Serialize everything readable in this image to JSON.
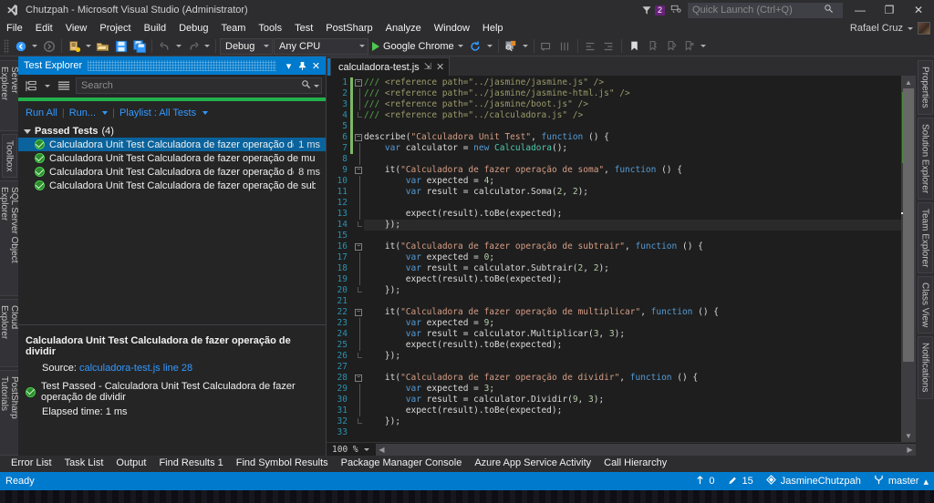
{
  "window": {
    "title": "Chutzpah - Microsoft Visual Studio (Administrator)",
    "minimize": "—",
    "restore": "❐",
    "close": "✕",
    "notification_count": "2",
    "user_name": "Rafael Cruz"
  },
  "quick_launch": {
    "placeholder": "Quick Launch (Ctrl+Q)",
    "value": ""
  },
  "menu": {
    "items": [
      {
        "label": "File"
      },
      {
        "label": "Edit"
      },
      {
        "label": "View"
      },
      {
        "label": "Project"
      },
      {
        "label": "Build"
      },
      {
        "label": "Debug"
      },
      {
        "label": "Team"
      },
      {
        "label": "Tools"
      },
      {
        "label": "Test"
      },
      {
        "label": "PostSharp"
      },
      {
        "label": "Analyze"
      },
      {
        "label": "Window"
      },
      {
        "label": "Help"
      }
    ]
  },
  "toolbar": {
    "config": "Debug",
    "platform": "Any CPU",
    "run_target": "Google Chrome"
  },
  "left_tabs": [
    {
      "label": "Server Explorer"
    },
    {
      "label": "Toolbox"
    },
    {
      "label": "SQL Server Object Explorer"
    },
    {
      "label": "Cloud Explorer"
    },
    {
      "label": "PostSharp Tutorials"
    }
  ],
  "right_tabs": [
    {
      "label": "Properties"
    },
    {
      "label": "Solution Explorer"
    },
    {
      "label": "Team Explorer"
    },
    {
      "label": "Class View"
    },
    {
      "label": "Notifications"
    }
  ],
  "test_explorer": {
    "title": "Test Explorer",
    "dropdown_glyph": "▾",
    "pin_glyph": "✕",
    "close_glyph": "✕",
    "search": {
      "placeholder": "Search",
      "value": ""
    },
    "run_all": "Run All",
    "run": "Run...",
    "playlist": "Playlist : All Tests",
    "group": {
      "label": "Passed Tests",
      "count": "(4)"
    },
    "tests": [
      {
        "name": "Calculadora Unit Test Calculadora de fazer operação de dividir",
        "duration": "1 ms",
        "selected": true
      },
      {
        "name": "Calculadora Unit Test Calculadora de fazer operação de multiplicar",
        "duration": "",
        "selected": false
      },
      {
        "name": "Calculadora Unit Test Calculadora de fazer operação de soma",
        "duration": "8 ms",
        "selected": false
      },
      {
        "name": "Calculadora Unit Test Calculadora de fazer operação de subtrair",
        "duration": "",
        "selected": false
      }
    ],
    "detail": {
      "title": "Calculadora Unit Test Calculadora de fazer operação de dividir",
      "source_label": "Source:",
      "source_link": "calculadora-test.js line 28",
      "result": "Test Passed - Calculadora Unit Test Calculadora de fazer operação de dividir",
      "elapsed": "Elapsed time: 1 ms"
    }
  },
  "editor": {
    "tab": {
      "label": "calculadora-test.js",
      "pin": "⇲",
      "close": "✕"
    },
    "zoom": "100 %",
    "lines": [
      {
        "n": 1,
        "fold": "box",
        "tokens": [
          {
            "t": "/// ",
            "c": "c-com"
          },
          {
            "t": "<reference path=\"../jasmine/jasmine.js\" />",
            "c": "c-comx"
          }
        ]
      },
      {
        "n": 2,
        "fold": "bar",
        "tokens": [
          {
            "t": "/// ",
            "c": "c-com"
          },
          {
            "t": "<reference path=\"../jasmine/jasmine-html.js\" />",
            "c": "c-comx"
          }
        ]
      },
      {
        "n": 3,
        "fold": "bar",
        "tokens": [
          {
            "t": "/// ",
            "c": "c-com"
          },
          {
            "t": "<reference path=\"../jasmine/boot.js\" />",
            "c": "c-comx"
          }
        ]
      },
      {
        "n": 4,
        "fold": "end",
        "tokens": [
          {
            "t": "/// ",
            "c": "c-com"
          },
          {
            "t": "<reference path=\"../calculadora.js\" />",
            "c": "c-comx"
          }
        ]
      },
      {
        "n": 5,
        "fold": "",
        "tokens": []
      },
      {
        "n": 6,
        "fold": "box",
        "tokens": [
          {
            "t": "describe",
            "c": "c-pl"
          },
          {
            "t": "(",
            "c": "c-pl"
          },
          {
            "t": "\"Calculadora Unit Test\"",
            "c": "c-str"
          },
          {
            "t": ", ",
            "c": "c-pl"
          },
          {
            "t": "function",
            "c": "c-kw"
          },
          {
            "t": " () {",
            "c": "c-pl"
          }
        ]
      },
      {
        "n": 7,
        "fold": "bar",
        "tokens": [
          {
            "t": "    ",
            "c": "c-pl"
          },
          {
            "t": "var",
            "c": "c-kw"
          },
          {
            "t": " calculator = ",
            "c": "c-pl"
          },
          {
            "t": "new",
            "c": "c-kw"
          },
          {
            "t": " ",
            "c": "c-pl"
          },
          {
            "t": "Calculadora",
            "c": "c-type"
          },
          {
            "t": "();",
            "c": "c-pl"
          }
        ]
      },
      {
        "n": 8,
        "fold": "bar",
        "tokens": []
      },
      {
        "n": 9,
        "fold": "box",
        "tokens": [
          {
            "t": "    ",
            "c": "c-pl"
          },
          {
            "t": "it",
            "c": "c-pl"
          },
          {
            "t": "(",
            "c": "c-pl"
          },
          {
            "t": "\"Calculadora de fazer operação de soma\"",
            "c": "c-str"
          },
          {
            "t": ", ",
            "c": "c-pl"
          },
          {
            "t": "function",
            "c": "c-kw"
          },
          {
            "t": " () {",
            "c": "c-pl"
          }
        ]
      },
      {
        "n": 10,
        "fold": "bar",
        "tokens": [
          {
            "t": "        ",
            "c": "c-pl"
          },
          {
            "t": "var",
            "c": "c-kw"
          },
          {
            "t": " expected = ",
            "c": "c-pl"
          },
          {
            "t": "4",
            "c": "c-num"
          },
          {
            "t": ";",
            "c": "c-pl"
          }
        ]
      },
      {
        "n": 11,
        "fold": "bar",
        "tokens": [
          {
            "t": "        ",
            "c": "c-pl"
          },
          {
            "t": "var",
            "c": "c-kw"
          },
          {
            "t": " result = calculator.Soma(",
            "c": "c-pl"
          },
          {
            "t": "2",
            "c": "c-num"
          },
          {
            "t": ", ",
            "c": "c-pl"
          },
          {
            "t": "2",
            "c": "c-num"
          },
          {
            "t": ");",
            "c": "c-pl"
          }
        ]
      },
      {
        "n": 12,
        "fold": "bar",
        "tokens": []
      },
      {
        "n": 13,
        "fold": "bar",
        "tokens": [
          {
            "t": "        expect(result).toBe(expected);",
            "c": "c-pl"
          }
        ]
      },
      {
        "n": 14,
        "fold": "end",
        "cur": true,
        "tokens": [
          {
            "t": "    });",
            "c": "c-pl"
          }
        ]
      },
      {
        "n": 15,
        "fold": "",
        "tokens": []
      },
      {
        "n": 16,
        "fold": "box",
        "tokens": [
          {
            "t": "    ",
            "c": "c-pl"
          },
          {
            "t": "it",
            "c": "c-pl"
          },
          {
            "t": "(",
            "c": "c-pl"
          },
          {
            "t": "\"Calculadora de fazer operação de subtrair\"",
            "c": "c-str"
          },
          {
            "t": ", ",
            "c": "c-pl"
          },
          {
            "t": "function",
            "c": "c-kw"
          },
          {
            "t": " () {",
            "c": "c-pl"
          }
        ]
      },
      {
        "n": 17,
        "fold": "bar",
        "tokens": [
          {
            "t": "        ",
            "c": "c-pl"
          },
          {
            "t": "var",
            "c": "c-kw"
          },
          {
            "t": " expected = ",
            "c": "c-pl"
          },
          {
            "t": "0",
            "c": "c-num"
          },
          {
            "t": ";",
            "c": "c-pl"
          }
        ]
      },
      {
        "n": 18,
        "fold": "bar",
        "tokens": [
          {
            "t": "        ",
            "c": "c-pl"
          },
          {
            "t": "var",
            "c": "c-kw"
          },
          {
            "t": " result = calculator.Subtrair(",
            "c": "c-pl"
          },
          {
            "t": "2",
            "c": "c-num"
          },
          {
            "t": ", ",
            "c": "c-pl"
          },
          {
            "t": "2",
            "c": "c-num"
          },
          {
            "t": ");",
            "c": "c-pl"
          }
        ]
      },
      {
        "n": 19,
        "fold": "bar",
        "tokens": [
          {
            "t": "        expect(result).toBe(expected);",
            "c": "c-pl"
          }
        ]
      },
      {
        "n": 20,
        "fold": "end",
        "tokens": [
          {
            "t": "    });",
            "c": "c-pl"
          }
        ]
      },
      {
        "n": 21,
        "fold": "",
        "tokens": []
      },
      {
        "n": 22,
        "fold": "box",
        "tokens": [
          {
            "t": "    ",
            "c": "c-pl"
          },
          {
            "t": "it",
            "c": "c-pl"
          },
          {
            "t": "(",
            "c": "c-pl"
          },
          {
            "t": "\"Calculadora de fazer operação de multiplicar\"",
            "c": "c-str"
          },
          {
            "t": ", ",
            "c": "c-pl"
          },
          {
            "t": "function",
            "c": "c-kw"
          },
          {
            "t": " () {",
            "c": "c-pl"
          }
        ]
      },
      {
        "n": 23,
        "fold": "bar",
        "tokens": [
          {
            "t": "        ",
            "c": "c-pl"
          },
          {
            "t": "var",
            "c": "c-kw"
          },
          {
            "t": " expected = ",
            "c": "c-pl"
          },
          {
            "t": "9",
            "c": "c-num"
          },
          {
            "t": ";",
            "c": "c-pl"
          }
        ]
      },
      {
        "n": 24,
        "fold": "bar",
        "tokens": [
          {
            "t": "        ",
            "c": "c-pl"
          },
          {
            "t": "var",
            "c": "c-kw"
          },
          {
            "t": " result = calculator.Multiplicar(",
            "c": "c-pl"
          },
          {
            "t": "3",
            "c": "c-num"
          },
          {
            "t": ", ",
            "c": "c-pl"
          },
          {
            "t": "3",
            "c": "c-num"
          },
          {
            "t": ");",
            "c": "c-pl"
          }
        ]
      },
      {
        "n": 25,
        "fold": "bar",
        "tokens": [
          {
            "t": "        expect(result).toBe(expected);",
            "c": "c-pl"
          }
        ]
      },
      {
        "n": 26,
        "fold": "end",
        "tokens": [
          {
            "t": "    });",
            "c": "c-pl"
          }
        ]
      },
      {
        "n": 27,
        "fold": "",
        "tokens": []
      },
      {
        "n": 28,
        "fold": "box",
        "tokens": [
          {
            "t": "    ",
            "c": "c-pl"
          },
          {
            "t": "it",
            "c": "c-pl"
          },
          {
            "t": "(",
            "c": "c-pl"
          },
          {
            "t": "\"Calculadora de fazer operação de dividir\"",
            "c": "c-str"
          },
          {
            "t": ", ",
            "c": "c-pl"
          },
          {
            "t": "function",
            "c": "c-kw"
          },
          {
            "t": " () {",
            "c": "c-pl"
          }
        ]
      },
      {
        "n": 29,
        "fold": "bar",
        "tokens": [
          {
            "t": "        ",
            "c": "c-pl"
          },
          {
            "t": "var",
            "c": "c-kw"
          },
          {
            "t": " expected = ",
            "c": "c-pl"
          },
          {
            "t": "3",
            "c": "c-num"
          },
          {
            "t": ";",
            "c": "c-pl"
          }
        ]
      },
      {
        "n": 30,
        "fold": "bar",
        "tokens": [
          {
            "t": "        ",
            "c": "c-pl"
          },
          {
            "t": "var",
            "c": "c-kw"
          },
          {
            "t": " result = calculator.Dividir(",
            "c": "c-pl"
          },
          {
            "t": "9",
            "c": "c-num"
          },
          {
            "t": ", ",
            "c": "c-pl"
          },
          {
            "t": "3",
            "c": "c-num"
          },
          {
            "t": ");",
            "c": "c-pl"
          }
        ]
      },
      {
        "n": 31,
        "fold": "bar",
        "tokens": [
          {
            "t": "        expect(result).toBe(expected);",
            "c": "c-pl"
          }
        ]
      },
      {
        "n": 32,
        "fold": "end",
        "tokens": [
          {
            "t": "    });",
            "c": "c-pl"
          }
        ]
      },
      {
        "n": 33,
        "fold": "",
        "tokens": []
      }
    ]
  },
  "bottom_tabs": [
    {
      "label": "Error List"
    },
    {
      "label": "Task List"
    },
    {
      "label": "Output"
    },
    {
      "label": "Find Results 1"
    },
    {
      "label": "Find Symbol Results"
    },
    {
      "label": "Package Manager Console"
    },
    {
      "label": "Azure App Service Activity"
    },
    {
      "label": "Call Hierarchy"
    }
  ],
  "status": {
    "message": "Ready",
    "unpublished": "0",
    "changes": "15",
    "repository": "JasmineChutzpah",
    "branch": "master",
    "branch_caret": "▴"
  },
  "colors": {
    "accent": "#007acc",
    "pass_green": "#22b14c",
    "purple_badge": "#68217a",
    "selection": "#0a639c",
    "link": "#3399ff"
  }
}
